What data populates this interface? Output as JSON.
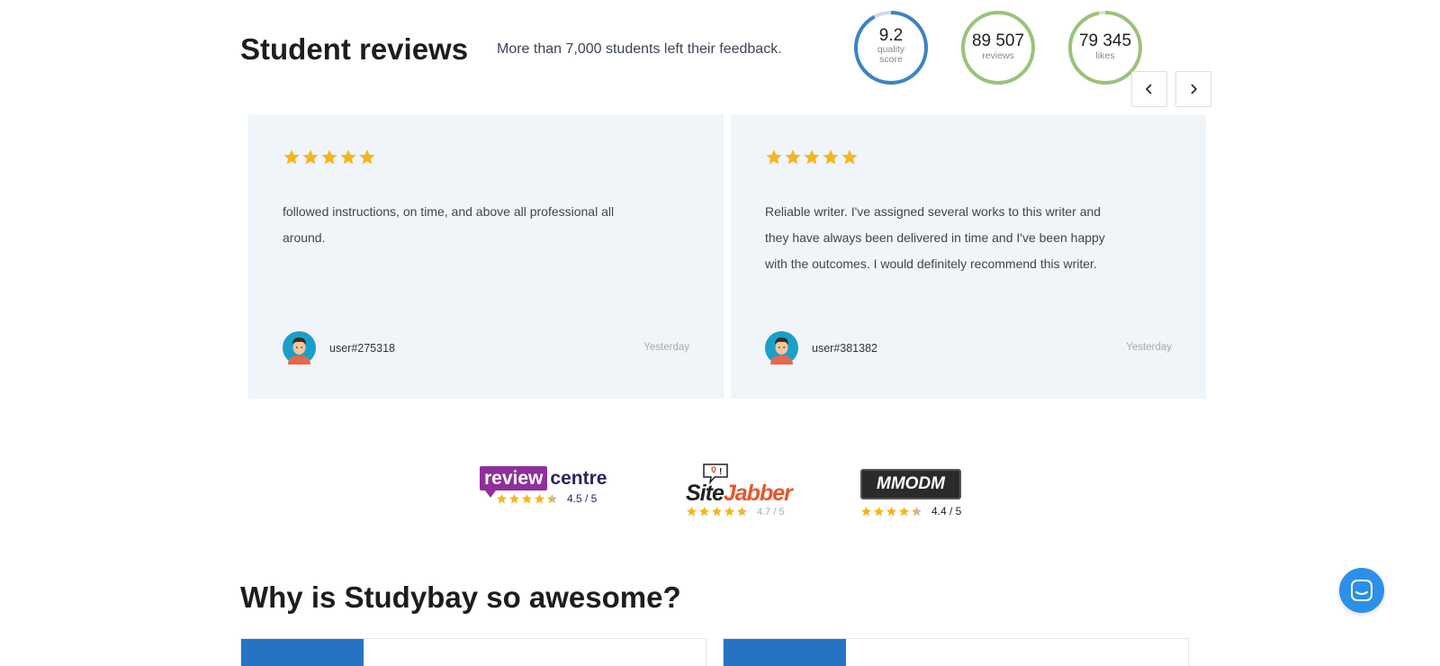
{
  "reviews_section": {
    "title": "Student reviews",
    "subtitle": "More than 7,000 students left their feedback.",
    "stats": {
      "quality": {
        "value": "9.2",
        "label_line1": "quality",
        "label_line2": "score",
        "progress": 0.92,
        "color": "#3d83c4"
      },
      "reviews": {
        "value": "89 507",
        "label": "reviews",
        "progress": 1.0,
        "color": "#9bc27a"
      },
      "likes": {
        "value": "79 345",
        "label": "likes",
        "progress": 0.97,
        "color": "#9bc27a"
      }
    },
    "nav": {
      "prev_icon": "chevron-left-icon",
      "next_icon": "chevron-right-icon"
    },
    "cards": [
      {
        "rating": 5,
        "text": "followed instructions, on time, and above all professional all around.",
        "user": "user#275318",
        "date": "Yesterday"
      },
      {
        "rating": 5,
        "text": "Reliable writer. I've assigned several works to this writer and they have always been delivered in time and I've been happy with the outcomes. I would definitely recommend this writer.",
        "user": "user#381382",
        "date": "Yesterday"
      }
    ]
  },
  "rating_sites": [
    {
      "name_part1": "review",
      "name_part2": "centre",
      "rating": "4.5 / 5",
      "stars": 4.5
    },
    {
      "name_part1": "Site",
      "name_part2": "Jabber",
      "rating": "4.7 / 5",
      "stars": 4.7
    },
    {
      "name": "MMODM",
      "rating": "4.4 / 5",
      "stars": 4.4
    }
  ],
  "why_section": {
    "title": "Why is Studybay so awesome?"
  },
  "colors": {
    "star": "#f5b61c",
    "accent_blue": "#2673c6",
    "chat_blue": "#2c8fe8",
    "card_bg": "#f0f5fa"
  }
}
